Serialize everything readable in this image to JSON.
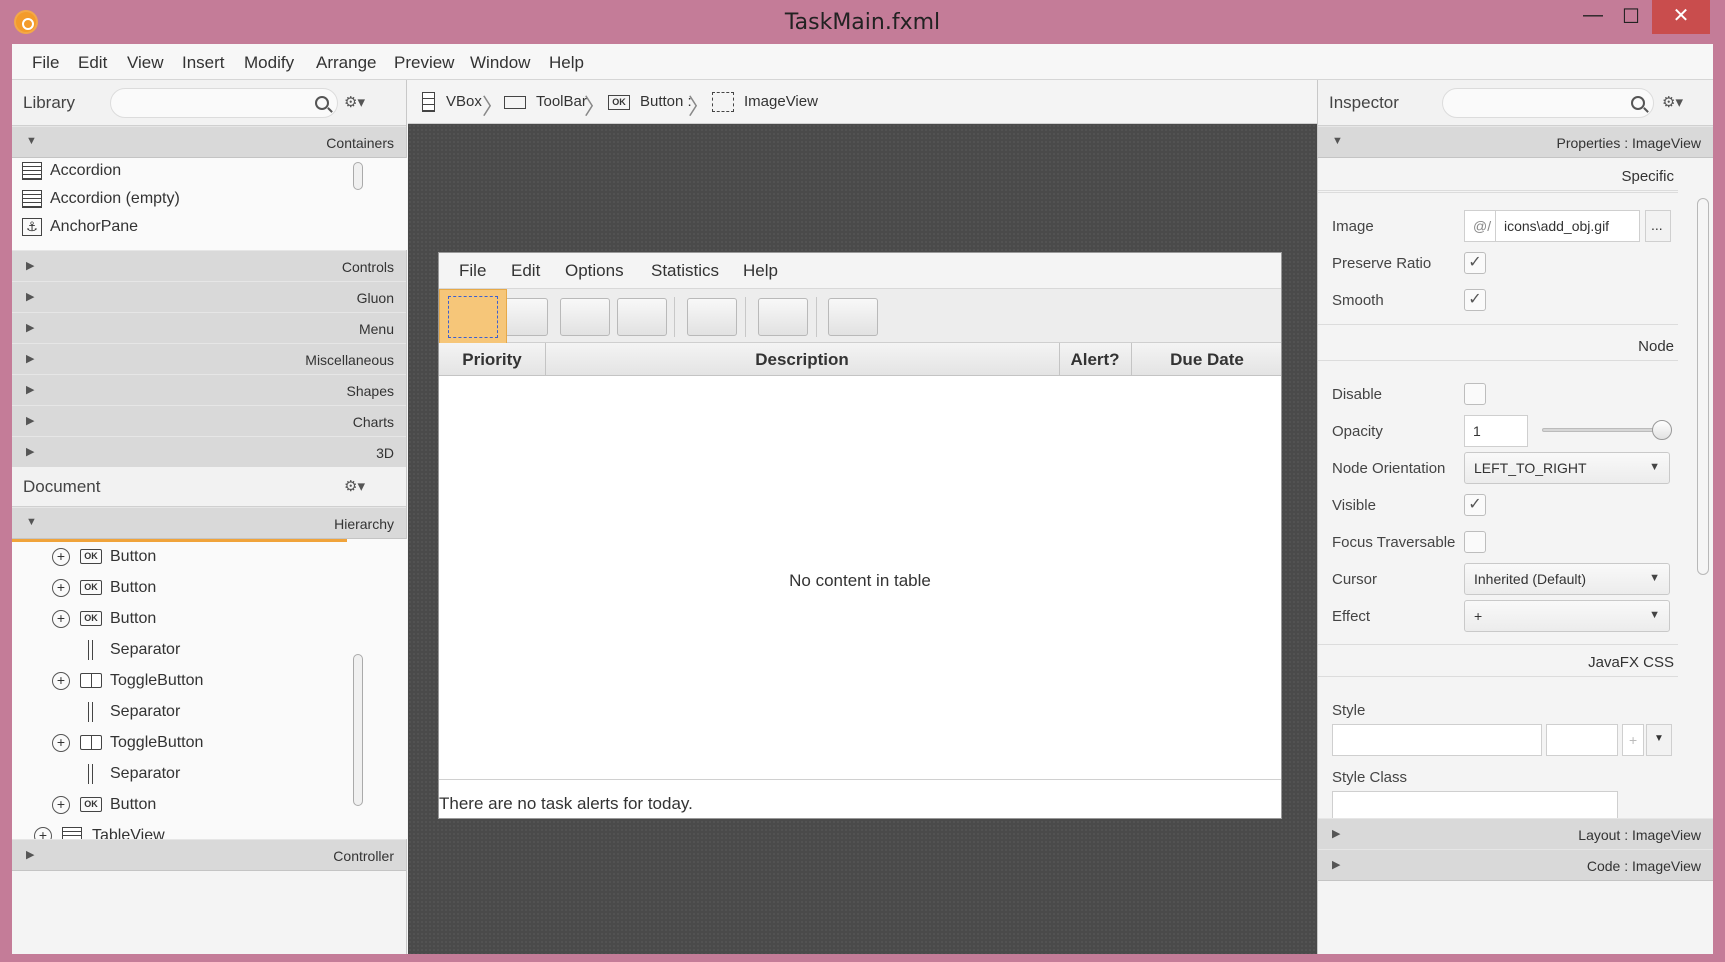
{
  "window": {
    "title": "TaskMain.fxml",
    "controls": {
      "minimize": "—",
      "maximize": "☐",
      "close": "✕"
    }
  },
  "menubar": [
    "File",
    "Edit",
    "View",
    "Insert",
    "Modify",
    "Arrange",
    "Preview",
    "Window",
    "Help"
  ],
  "library": {
    "title": "Library",
    "search_placeholder": "",
    "sections": {
      "containers": "Containers",
      "controls": "Controls",
      "gluon": "Gluon",
      "menu": "Menu",
      "miscellaneous": "Miscellaneous",
      "shapes": "Shapes",
      "charts": "Charts",
      "three_d": "3D"
    },
    "container_items": [
      {
        "label": "Accordion",
        "icon": "accordion-icon"
      },
      {
        "label": "Accordion  (empty)",
        "icon": "accordion-icon"
      },
      {
        "label": "AnchorPane",
        "icon": "anchorpane-icon"
      }
    ]
  },
  "document": {
    "title": "Document",
    "hierarchy_label": "Hierarchy",
    "controller_label": "Controller",
    "tree": [
      {
        "label": "Button",
        "kind": "button",
        "expandable": true
      },
      {
        "label": "Button",
        "kind": "button",
        "expandable": true
      },
      {
        "label": "Button",
        "kind": "button",
        "expandable": true
      },
      {
        "label": "Separator",
        "kind": "separator",
        "expandable": false
      },
      {
        "label": "ToggleButton",
        "kind": "toggle",
        "expandable": true
      },
      {
        "label": "Separator",
        "kind": "separator",
        "expandable": false
      },
      {
        "label": "ToggleButton",
        "kind": "toggle",
        "expandable": true
      },
      {
        "label": "Separator",
        "kind": "separator",
        "expandable": false
      },
      {
        "label": "Button",
        "kind": "button",
        "expandable": true
      },
      {
        "label": "TableView",
        "kind": "table",
        "expandable": true
      }
    ],
    "ok_glyph": "OK"
  },
  "breadcrumb": [
    {
      "label": "VBox",
      "icon": "vbox-icon"
    },
    {
      "label": "ToolBar",
      "icon": "toolbar-icon"
    },
    {
      "label": "Button :",
      "icon": "button-icon"
    },
    {
      "label": "ImageView",
      "icon": "imageview-icon"
    }
  ],
  "preview": {
    "menu": [
      "File",
      "Edit",
      "Options",
      "Statistics",
      "Help"
    ],
    "table_columns": [
      "Priority",
      "Description",
      "Alert?",
      "Due Date"
    ],
    "empty_text": "No content in table",
    "status_text": "There are no task alerts for today."
  },
  "inspector": {
    "title": "Inspector",
    "properties_label": "Properties : ImageView",
    "sections": {
      "specific": "Specific",
      "node": "Node",
      "css": "JavaFX CSS"
    },
    "image": {
      "label": "Image",
      "prefix": "@/",
      "value": "icons\\add_obj.gif",
      "browse": "..."
    },
    "preserve_ratio": {
      "label": "Preserve Ratio",
      "checked": true
    },
    "smooth": {
      "label": "Smooth",
      "checked": true
    },
    "disable": {
      "label": "Disable",
      "checked": false
    },
    "opacity": {
      "label": "Opacity",
      "value": "1",
      "slider_fraction": 1.0
    },
    "node_orientation": {
      "label": "Node Orientation",
      "value": "LEFT_TO_RIGHT"
    },
    "visible": {
      "label": "Visible",
      "checked": true
    },
    "focus_traversable": {
      "label": "Focus Traversable",
      "checked": false
    },
    "cursor": {
      "label": "Cursor",
      "value": "Inherited (Default)"
    },
    "effect": {
      "label": "Effect",
      "value": "+"
    },
    "style": {
      "label": "Style",
      "value": "",
      "plus": "+"
    },
    "style_class": {
      "label": "Style Class"
    },
    "layout_label": "Layout : ImageView",
    "code_label": "Code : ImageView"
  },
  "colors": {
    "window_frame": "#c47c98",
    "close_button": "#c94d4d",
    "selection_highlight": "#f6c679",
    "canvas_bg": "#4a4a4a"
  }
}
